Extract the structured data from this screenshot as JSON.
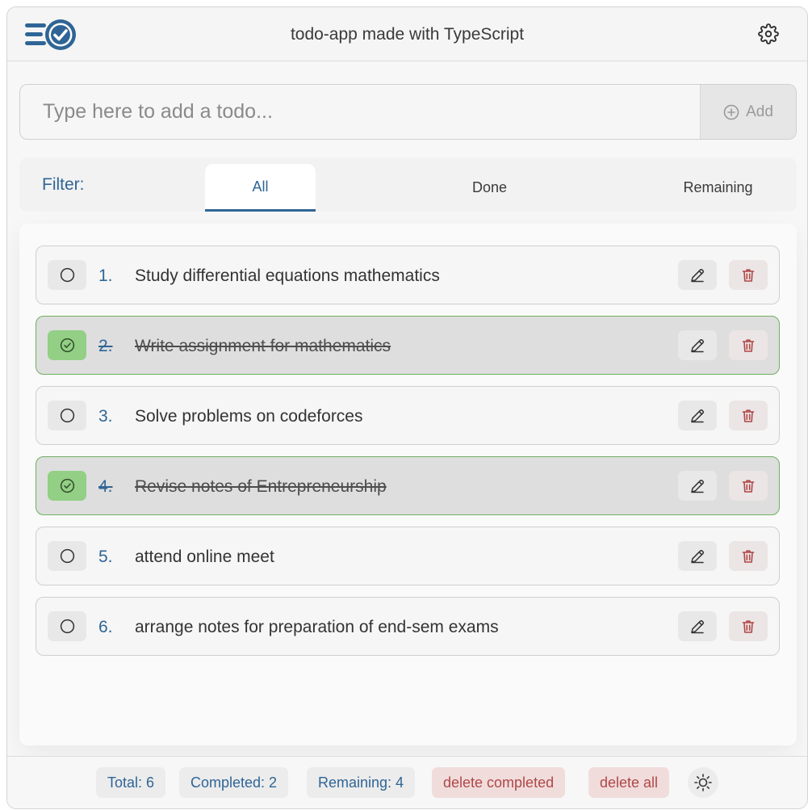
{
  "header": {
    "title": "todo-app made with TypeScript",
    "logo_icon": "list-check-icon",
    "settings_icon": "gear-icon"
  },
  "add": {
    "placeholder": "Type here to add a todo...",
    "button_label": "Add",
    "button_icon": "plus-circle-icon"
  },
  "filter": {
    "label": "Filter:",
    "tabs": [
      {
        "label": "All",
        "active": true
      },
      {
        "label": "Done",
        "active": false
      },
      {
        "label": "Remaining",
        "active": false
      }
    ]
  },
  "todos": [
    {
      "num": "1.",
      "text": "Study differential equations mathematics",
      "done": false
    },
    {
      "num": "2.",
      "text": "Write assignment for mathematics",
      "done": true
    },
    {
      "num": "3.",
      "text": "Solve problems on codeforces",
      "done": false
    },
    {
      "num": "4.",
      "text": "Revise notes of Entrepreneurship",
      "done": true
    },
    {
      "num": "5.",
      "text": "attend online meet",
      "done": false
    },
    {
      "num": "6.",
      "text": "arrange notes for preparation of end-sem exams",
      "done": false
    }
  ],
  "footer": {
    "total": "Total: 6",
    "completed": "Completed: 2",
    "remaining": "Remaining: 4",
    "delete_completed": "delete completed",
    "delete_all": "delete all",
    "theme_icon": "sun-icon"
  },
  "colors": {
    "accent": "#2f6596",
    "done_bg": "#93cf85",
    "done_border": "#70b160",
    "danger": "#b04747"
  }
}
